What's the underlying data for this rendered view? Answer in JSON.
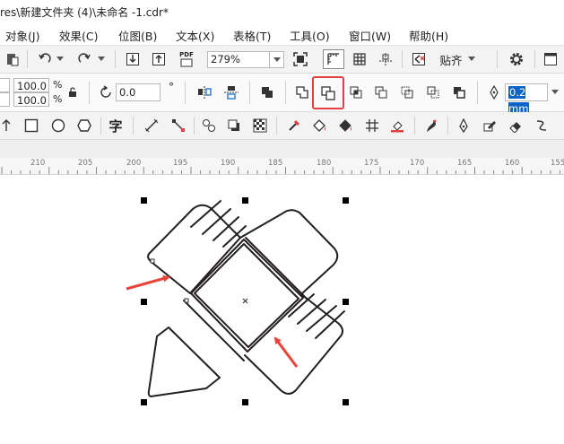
{
  "window": {
    "title": "res\\新建文件夹 (4)\\未命名 -1.cdr*"
  },
  "menu": {
    "items": [
      {
        "id": "object",
        "label": "对象(J)"
      },
      {
        "id": "effects",
        "label": "效果(C)"
      },
      {
        "id": "bitmaps",
        "label": "位图(B)"
      },
      {
        "id": "text",
        "label": "文本(X)"
      },
      {
        "id": "table",
        "label": "表格(T)"
      },
      {
        "id": "tools",
        "label": "工具(O)"
      },
      {
        "id": "window",
        "label": "窗口(W)"
      },
      {
        "id": "help",
        "label": "帮助(H)"
      }
    ]
  },
  "toolbar": {
    "zoom_value": "279%",
    "pdf_label": "PDF",
    "snap_label": "贴齐"
  },
  "propbar": {
    "scale_x": "100.0",
    "scale_y": "100.0",
    "percent": "%",
    "rotation": "0.0",
    "degree": "°",
    "outline_width": "0.2 mm"
  },
  "toolbox": {
    "text_tool_label": "字"
  },
  "ruler": {
    "labels": [
      "210",
      "205",
      "200",
      "195",
      "190",
      "185",
      "180",
      "175",
      "170",
      "165",
      "160",
      "155"
    ]
  },
  "colors": {
    "highlight": "#e04040",
    "arrow": "#e8443a",
    "selection_bg": "#0a64c8"
  }
}
